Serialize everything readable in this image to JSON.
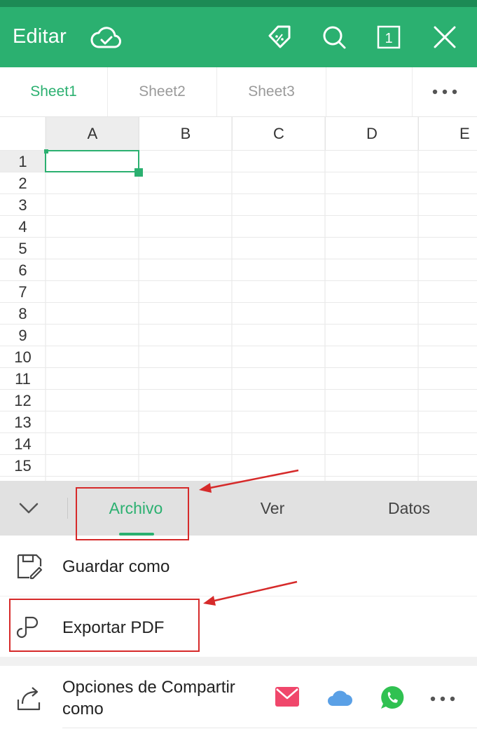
{
  "header": {
    "title": "Editar"
  },
  "sheet_tabs": [
    {
      "label": "Sheet1",
      "active": true
    },
    {
      "label": "Sheet2",
      "active": false
    },
    {
      "label": "Sheet3",
      "active": false
    }
  ],
  "grid": {
    "columns": [
      "A",
      "B",
      "C",
      "D",
      "E"
    ],
    "rows": [
      "1",
      "2",
      "3",
      "4",
      "5",
      "6",
      "7",
      "8",
      "9",
      "10",
      "11",
      "12",
      "13",
      "14",
      "15"
    ],
    "selected_cell": "A1"
  },
  "bottom_tabs": [
    {
      "label": "Archivo",
      "active": true
    },
    {
      "label": "Ver",
      "active": false
    },
    {
      "label": "Datos",
      "active": false
    }
  ],
  "menu": {
    "save_as": "Guardar como",
    "export_pdf": "Exportar PDF",
    "share_line1": "Opciones de Compartir",
    "share_line2": "como"
  },
  "colors": {
    "accent": "#2bb070",
    "highlight": "#d62a2a",
    "mail": "#f0476b",
    "cloud": "#5aa0e6",
    "whatsapp": "#30c151"
  },
  "icons": [
    "cloud-check-icon",
    "tag-percent-icon",
    "search-icon",
    "sheet-count-icon",
    "close-icon",
    "more-icon",
    "chevron-down-icon",
    "save-as-icon",
    "export-pdf-icon",
    "share-icon",
    "mail-icon",
    "cloud-icon",
    "whatsapp-icon"
  ]
}
